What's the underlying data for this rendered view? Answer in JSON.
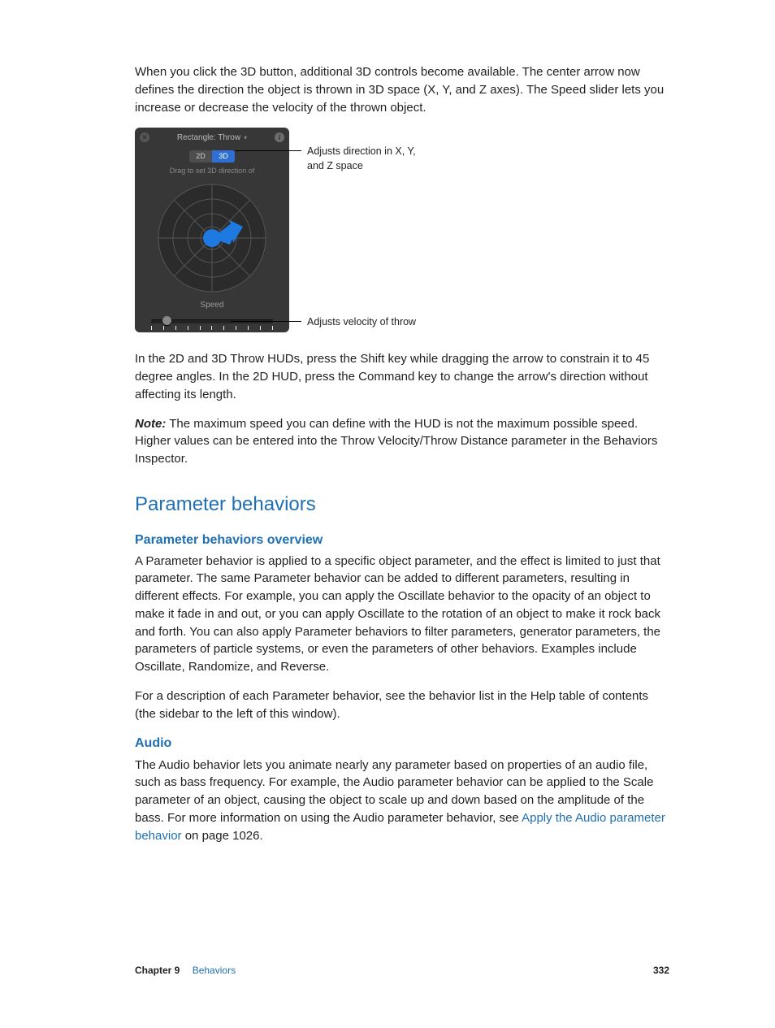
{
  "intro": "When you click the 3D button, additional 3D controls become available. The center arrow now defines the direction the object is thrown in 3D space (X, Y, and Z axes). The Speed slider lets you increase or decrease the velocity of the thrown object.",
  "hud": {
    "title": "Rectangle: Throw",
    "seg_off": "2D",
    "seg_on": "3D",
    "sub": "Drag to set 3D direction of",
    "speed": "Speed"
  },
  "callout1": "Adjusts direction in X, Y, and Z space",
  "callout2": "Adjusts velocity of throw",
  "para2": "In the 2D and 3D Throw HUDs, press the Shift key while dragging the arrow to constrain it to 45 degree angles. In the 2D HUD, press the Command key to change the arrow's direction without affecting its length.",
  "note_label": "Note:",
  "note_body": "  The maximum speed you can define with the HUD is not the maximum possible speed. Higher values can be entered into the Throw Velocity/Throw Distance parameter in the Behaviors Inspector.",
  "sec_title": "Parameter behaviors",
  "sub1_title": "Parameter behaviors overview",
  "sub1_p1": "A Parameter behavior is applied to a specific object parameter, and the effect is limited to just that parameter. The same Parameter behavior can be added to different parameters, resulting in different effects. For example, you can apply the Oscillate behavior to the opacity of an object to make it fade in and out, or you can apply Oscillate to the rotation of an object to make it rock back and forth. You can also apply Parameter behaviors to filter parameters, generator parameters, the parameters of particle systems, or even the parameters of other behaviors. Examples include Oscillate, Randomize, and Reverse.",
  "sub1_p2": "For a description of each Parameter behavior, see the behavior list in the Help table of contents (the sidebar to the left of this window).",
  "sub2_title": "Audio",
  "sub2_p1a": "The Audio behavior lets you animate nearly any parameter based on properties of an audio file, such as bass frequency. For example, the Audio parameter behavior can be applied to the Scale parameter of an object, causing the object to scale up and down based on the amplitude of the bass. For more information on using the Audio parameter behavior, see ",
  "sub2_link": "Apply the Audio parameter behavior",
  "sub2_p1b": " on page 1026.",
  "footer": {
    "chapter": "Chapter 9",
    "section": "Behaviors",
    "page": "332"
  }
}
